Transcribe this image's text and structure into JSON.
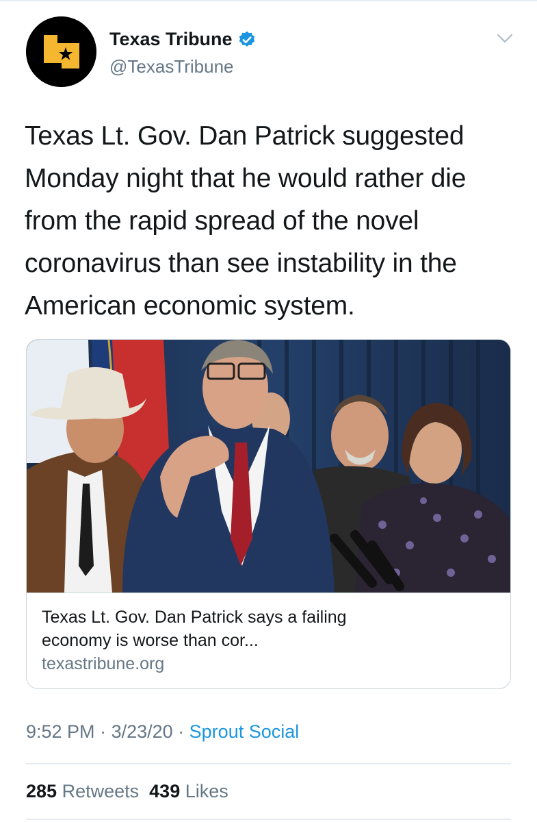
{
  "account": {
    "display_name": "Texas Tribune",
    "handle": "@TexasTribune",
    "verified_icon": "verified-badge-icon",
    "avatar_icon": "texas-tribune-logo-icon",
    "more_icon": "chevron-down-icon"
  },
  "tweet": {
    "text": "Texas Lt. Gov. Dan Patrick suggested Monday night that he would rather die from the rapid spread of the novel coronavirus than see instability in the American economic system."
  },
  "card": {
    "title_line1": "Texas Lt. Gov. Dan Patrick says a failing",
    "title_line2": "economy is worse than cor...",
    "domain": "texastribune.org"
  },
  "meta": {
    "time": "9:52 PM",
    "separator": " · ",
    "date": "3/23/20",
    "source": "Sprout Social"
  },
  "stats": {
    "retweets_count": "285",
    "retweets_label": "Retweets",
    "likes_count": "439",
    "likes_label": "Likes"
  },
  "colors": {
    "link_blue": "#1b95e0",
    "secondary_text": "#657786",
    "primary_text": "#14171a",
    "logo_yellow": "#f5b630"
  }
}
